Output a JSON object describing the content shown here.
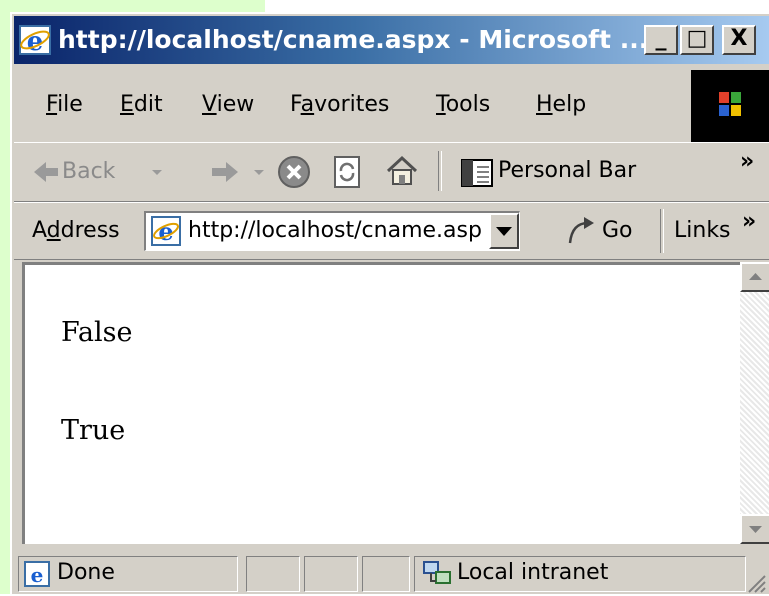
{
  "window": {
    "title": "http://localhost/cname.aspx - Microsoft ...",
    "controls": {
      "minimize": "_",
      "maximize": "□",
      "close": "X"
    }
  },
  "menu": {
    "items": [
      {
        "label": "File",
        "hot": "F",
        "rest": "ile"
      },
      {
        "label": "Edit",
        "hot": "E",
        "rest": "dit"
      },
      {
        "label": "View",
        "hot": "V",
        "rest": "iew"
      },
      {
        "label": "Favorites",
        "pre": "F",
        "hot": "a",
        "rest": "vorites"
      },
      {
        "label": "Tools",
        "hot": "T",
        "rest": "ools"
      },
      {
        "label": "Help",
        "hot": "H",
        "rest": "elp"
      }
    ]
  },
  "toolbar": {
    "back_label": "Back",
    "personal_bar_label": "Personal Bar",
    "overflow": "»"
  },
  "address": {
    "label_pre": "A",
    "label_hot": "d",
    "label_rest": "dress",
    "value": "http://localhost/cname.asp",
    "go_label": "Go",
    "links_label": "Links",
    "overflow": "»"
  },
  "content": {
    "lines": [
      "False",
      "True"
    ]
  },
  "status": {
    "text": "Done",
    "zone": "Local intranet"
  },
  "colors": {
    "title_start": "#0a246a",
    "title_end": "#a6caf0",
    "chrome": "#d4d0c8",
    "page_bg_green": "#ddffcc"
  }
}
